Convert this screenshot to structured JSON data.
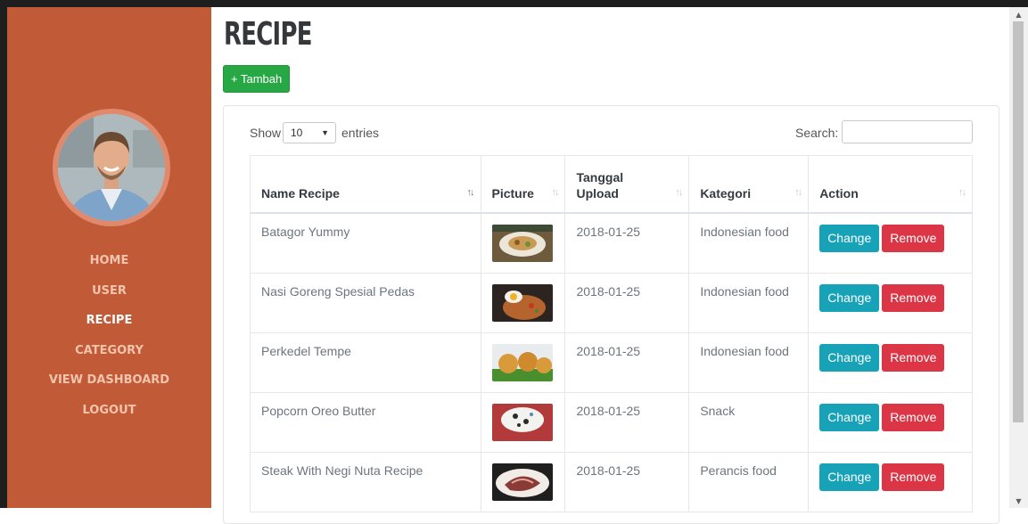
{
  "page": {
    "title": "RECIPE",
    "add_button": "+ Tambah"
  },
  "sidebar": {
    "avatar_alt": "profile photo",
    "items": [
      {
        "label": "HOME",
        "active": false
      },
      {
        "label": "USER",
        "active": false
      },
      {
        "label": "RECIPE",
        "active": true
      },
      {
        "label": "CATEGORY",
        "active": false
      },
      {
        "label": "VIEW DASHBOARD",
        "active": false
      },
      {
        "label": "LOGOUT",
        "active": false
      }
    ]
  },
  "table_controls": {
    "show_label": "Show",
    "entries_value": "10",
    "entries_suffix": "entries",
    "search_label": "Search:",
    "search_value": ""
  },
  "table": {
    "columns": [
      {
        "line1": "Name Recipe",
        "line2": ""
      },
      {
        "line1": "Picture",
        "line2": ""
      },
      {
        "line1": "Tanggal",
        "line2": "Upload"
      },
      {
        "line1": "Kategori",
        "line2": ""
      },
      {
        "line1": "Action",
        "line2": ""
      }
    ],
    "rows": [
      {
        "name": "Batagor Yummy",
        "date": "2018-01-25",
        "category": "Indonesian food",
        "change": "Change",
        "remove": "Remove"
      },
      {
        "name": "Nasi Goreng Spesial Pedas",
        "date": "2018-01-25",
        "category": "Indonesian food",
        "change": "Change",
        "remove": "Remove"
      },
      {
        "name": "Perkedel Tempe",
        "date": "2018-01-25",
        "category": "Indonesian food",
        "change": "Change",
        "remove": "Remove"
      },
      {
        "name": "Popcorn Oreo Butter",
        "date": "2018-01-25",
        "category": "Snack",
        "change": "Change",
        "remove": "Remove"
      },
      {
        "name": "Steak With Negi Nuta Recipe",
        "date": "2018-01-25",
        "category": "Perancis food",
        "change": "Change",
        "remove": "Remove"
      }
    ]
  },
  "colors": {
    "sidebar": "#c05a37",
    "accent_add": "#28a745",
    "btn_change": "#17a2b8",
    "btn_remove": "#dc3545"
  }
}
